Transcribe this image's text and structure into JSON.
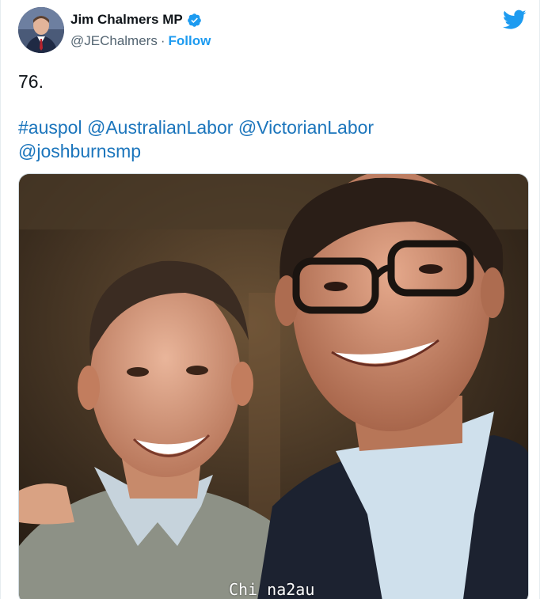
{
  "tweet": {
    "author": {
      "display_name": "Jim Chalmers MP",
      "handle": "@JEChalmers",
      "separator": "·",
      "verified_icon": "verified-badge-icon",
      "avatar_icon": "avatar"
    },
    "follow_label": "Follow",
    "text_line1": "76.",
    "entities": [
      {
        "text": "#auspol",
        "type": "hashtag"
      },
      {
        "text": "@AustralianLabor",
        "type": "mention"
      },
      {
        "text": "@VictorianLabor",
        "type": "mention"
      },
      {
        "text": "@joshburnsmp",
        "type": "mention"
      }
    ],
    "logo_icon": "twitter-bird-icon",
    "media": {
      "kind": "photo"
    }
  },
  "watermark": "Chi na2au",
  "colors": {
    "accent": "#1d9bf0",
    "link": "#1b75bc",
    "text": "#0f1419",
    "muted": "#536471"
  }
}
